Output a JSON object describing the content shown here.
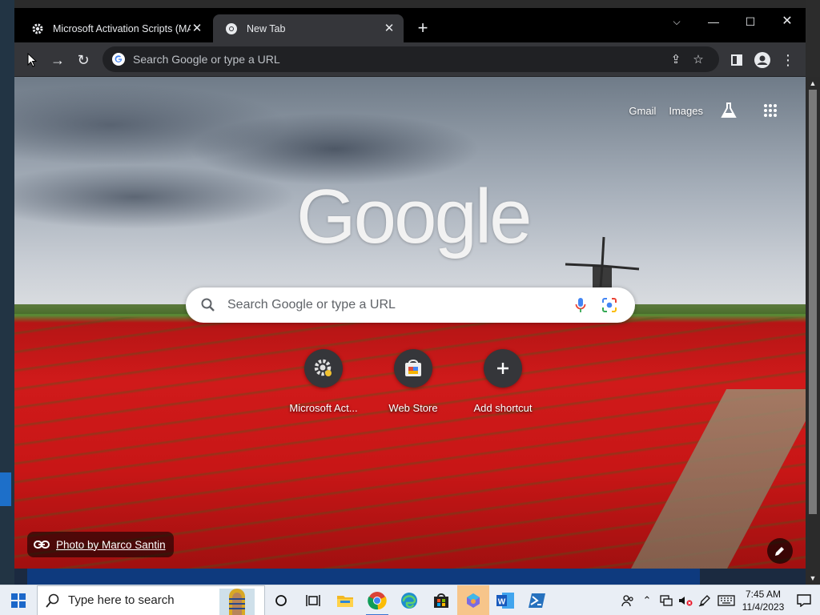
{
  "browser": {
    "tabs": [
      {
        "title": "Microsoft Activation Scripts (MA",
        "active": false,
        "icon": "gear-icon"
      },
      {
        "title": "New Tab",
        "active": true,
        "icon": "chrome-icon"
      }
    ],
    "omnibox": {
      "placeholder": "Search Google or type a URL"
    }
  },
  "ntp": {
    "top_links": {
      "gmail": "Gmail",
      "images": "Images"
    },
    "logo_text": "Google",
    "search_placeholder": "Search Google or type a URL",
    "shortcuts": [
      {
        "label": "Microsoft Act...",
        "icon": "gear-icon"
      },
      {
        "label": "Web Store",
        "icon": "web-store-icon"
      },
      {
        "label": "Add shortcut",
        "icon": "plus-icon"
      }
    ],
    "attribution": "Photo by Marco Santin"
  },
  "taskbar": {
    "search_placeholder": "Type here to search",
    "apps": [
      "cortana-icon",
      "task-view-icon",
      "file-explorer-icon",
      "chrome-icon",
      "edge-icon",
      "store-icon",
      "copilot-icon",
      "word-icon",
      "powershell-icon"
    ],
    "clock": {
      "time": "7:45 AM",
      "date": "11/4/2023"
    }
  },
  "colors": {
    "accent": "#3a74d1",
    "tab_active": "#35363a",
    "tulip_red": "#d01a1a"
  }
}
